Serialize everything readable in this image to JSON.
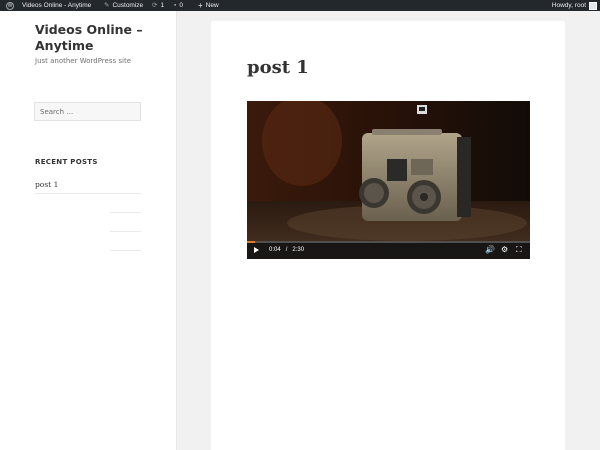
{
  "adminbar": {
    "site_name": "Videos Online - Anytime",
    "customize": "Customize",
    "updates_count": "1",
    "comments_count": "0",
    "new_label": "New",
    "howdy": "Howdy, root"
  },
  "sidebar": {
    "site_title": "Videos Online – Anytime",
    "description": "Just another WordPress site",
    "search_placeholder": "Search …",
    "recent_posts_title": "RECENT POSTS",
    "recent_posts": [
      "post 1"
    ]
  },
  "post": {
    "title": "post 1"
  },
  "video": {
    "current_time": "0:04",
    "separator": "/",
    "duration": "2:30",
    "progress_fraction": 0.027
  },
  "colors": {
    "adminbar_bg": "#23282d",
    "page_bg": "#f1f1f1",
    "progress_accent": "#e07a2c"
  }
}
